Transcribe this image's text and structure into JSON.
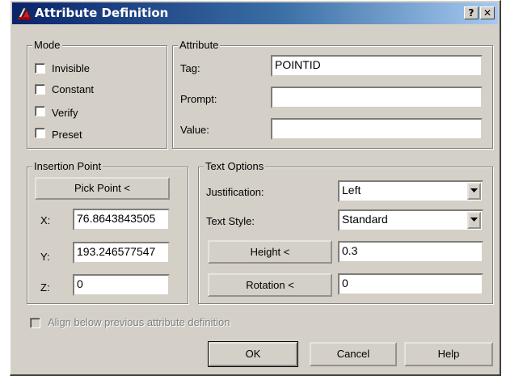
{
  "window": {
    "title": "Attribute Definition",
    "help_label": "?",
    "close_label": "✕"
  },
  "mode": {
    "legend": "Mode",
    "options": [
      {
        "label": "Invisible",
        "checked": false
      },
      {
        "label": "Constant",
        "checked": false
      },
      {
        "label": "Verify",
        "checked": false
      },
      {
        "label": "Preset",
        "checked": false
      }
    ]
  },
  "attribute": {
    "legend": "Attribute",
    "tag_label": "Tag:",
    "tag_value": "POINTID",
    "prompt_label": "Prompt:",
    "prompt_value": "",
    "value_label": "Value:",
    "value_value": ""
  },
  "insertion": {
    "legend": "Insertion Point",
    "pick_label": "Pick Point <",
    "x_label": "X:",
    "x_value": "76.8643843505",
    "y_label": "Y:",
    "y_value": "193.246577547",
    "z_label": "Z:",
    "z_value": "0"
  },
  "text_options": {
    "legend": "Text Options",
    "justification_label": "Justification:",
    "justification_value": "Left",
    "style_label": "Text Style:",
    "style_value": "Standard",
    "height_button": "Height <",
    "height_value": "0.3",
    "rotation_button": "Rotation <",
    "rotation_value": "0"
  },
  "align_label": "Align below previous attribute definition",
  "buttons": {
    "ok": "OK",
    "cancel": "Cancel",
    "help": "Help"
  }
}
